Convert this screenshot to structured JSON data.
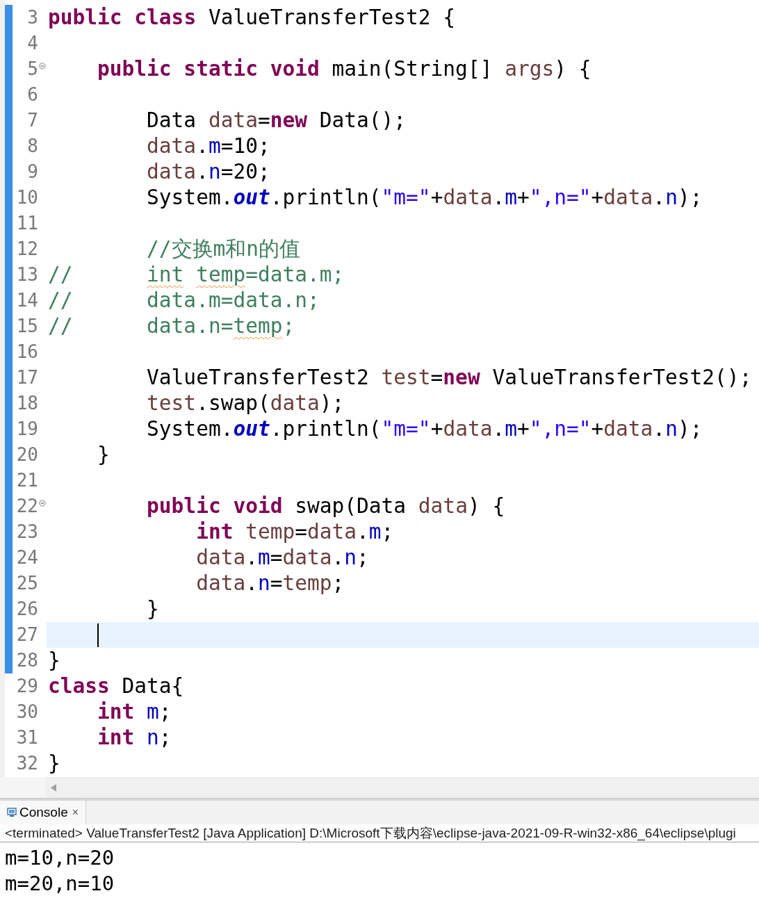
{
  "editor": {
    "lines": [
      {
        "number": "3",
        "changed": true,
        "tokens": [
          {
            "kind": "keyword",
            "text": "public"
          },
          {
            "kind": "keyword",
            "text": " class"
          },
          {
            "kind": "plain",
            "text": " ValueTransferTest2 {"
          }
        ]
      },
      {
        "number": "4",
        "changed": true
      },
      {
        "number": "5",
        "changed": true,
        "fold": true,
        "tokens": [
          {
            "kind": "keyword",
            "text": "    public"
          },
          {
            "kind": "keyword",
            "text": " static"
          },
          {
            "kind": "keyword",
            "text": " void"
          },
          {
            "kind": "plain",
            "text": " main(String[] "
          },
          {
            "kind": "variable",
            "text": "args"
          },
          {
            "kind": "plain",
            "text": ") {"
          }
        ]
      },
      {
        "number": "6",
        "changed": true
      },
      {
        "number": "7",
        "changed": true,
        "tokens": [
          {
            "kind": "plain",
            "text": "        Data "
          },
          {
            "kind": "variable",
            "text": "data"
          },
          {
            "kind": "plain",
            "text": "="
          },
          {
            "kind": "keyword",
            "text": "new"
          },
          {
            "kind": "plain",
            "text": " Data();"
          }
        ]
      },
      {
        "number": "8",
        "changed": true,
        "tokens": [
          {
            "kind": "variable",
            "text": "        data"
          },
          {
            "kind": "plain",
            "text": "."
          },
          {
            "kind": "field",
            "text": "m"
          },
          {
            "kind": "plain",
            "text": "=10;"
          }
        ]
      },
      {
        "number": "9",
        "changed": true,
        "tokens": [
          {
            "kind": "variable",
            "text": "        data"
          },
          {
            "kind": "plain",
            "text": "."
          },
          {
            "kind": "field",
            "text": "n"
          },
          {
            "kind": "plain",
            "text": "=20;"
          }
        ]
      },
      {
        "number": "10",
        "changed": true,
        "tokens": [
          {
            "kind": "plain",
            "text": "        System."
          },
          {
            "kind": "static",
            "text": "out"
          },
          {
            "kind": "plain",
            "text": ".println("
          },
          {
            "kind": "string",
            "text": "\"m=\""
          },
          {
            "kind": "plain",
            "text": "+"
          },
          {
            "kind": "variable",
            "text": "data"
          },
          {
            "kind": "plain",
            "text": "."
          },
          {
            "kind": "field",
            "text": "m"
          },
          {
            "kind": "plain",
            "text": "+"
          },
          {
            "kind": "string",
            "text": "\",n=\""
          },
          {
            "kind": "plain",
            "text": "+"
          },
          {
            "kind": "variable",
            "text": "data"
          },
          {
            "kind": "plain",
            "text": "."
          },
          {
            "kind": "field",
            "text": "n"
          },
          {
            "kind": "plain",
            "text": ");"
          }
        ]
      },
      {
        "number": "11",
        "changed": true
      },
      {
        "number": "12",
        "changed": true,
        "tokens": [
          {
            "kind": "comment",
            "text": "        //交换m和n的值"
          }
        ]
      },
      {
        "number": "13",
        "changed": true,
        "tokens": [
          {
            "kind": "comment",
            "text": "//      "
          },
          {
            "kind": "comment",
            "text": "int",
            "warning": true
          },
          {
            "kind": "comment",
            "text": " temp",
            "warning": true
          },
          {
            "kind": "comment",
            "text": "=data.m;"
          }
        ]
      },
      {
        "number": "14",
        "changed": true,
        "tokens": [
          {
            "kind": "comment",
            "text": "//      data.m=data.n;"
          }
        ]
      },
      {
        "number": "15",
        "changed": true,
        "tokens": [
          {
            "kind": "comment",
            "text": "//      data.n="
          },
          {
            "kind": "comment",
            "text": "temp",
            "warning": true
          },
          {
            "kind": "comment",
            "text": ";"
          }
        ]
      },
      {
        "number": "16",
        "changed": true
      },
      {
        "number": "17",
        "changed": true,
        "tokens": [
          {
            "kind": "plain",
            "text": "        ValueTransferTest2 "
          },
          {
            "kind": "variable",
            "text": "test"
          },
          {
            "kind": "plain",
            "text": "="
          },
          {
            "kind": "keyword",
            "text": "new"
          },
          {
            "kind": "plain",
            "text": " ValueTransferTest2();"
          }
        ]
      },
      {
        "number": "18",
        "changed": true,
        "tokens": [
          {
            "kind": "variable",
            "text": "        test"
          },
          {
            "kind": "plain",
            "text": ".swap("
          },
          {
            "kind": "variable",
            "text": "data"
          },
          {
            "kind": "plain",
            "text": ");"
          }
        ]
      },
      {
        "number": "19",
        "changed": true,
        "tokens": [
          {
            "kind": "plain",
            "text": "        System."
          },
          {
            "kind": "static",
            "text": "out"
          },
          {
            "kind": "plain",
            "text": ".println("
          },
          {
            "kind": "string",
            "text": "\"m=\""
          },
          {
            "kind": "plain",
            "text": "+"
          },
          {
            "kind": "variable",
            "text": "data"
          },
          {
            "kind": "plain",
            "text": "."
          },
          {
            "kind": "field",
            "text": "m"
          },
          {
            "kind": "plain",
            "text": "+"
          },
          {
            "kind": "string",
            "text": "\",n=\""
          },
          {
            "kind": "plain",
            "text": "+"
          },
          {
            "kind": "variable",
            "text": "data"
          },
          {
            "kind": "plain",
            "text": "."
          },
          {
            "kind": "field",
            "text": "n"
          },
          {
            "kind": "plain",
            "text": ");"
          }
        ]
      },
      {
        "number": "20",
        "changed": true,
        "tokens": [
          {
            "kind": "plain",
            "text": "    }"
          }
        ]
      },
      {
        "number": "21",
        "changed": true
      },
      {
        "number": "22",
        "changed": true,
        "fold": true,
        "tokens": [
          {
            "kind": "keyword",
            "text": "        public"
          },
          {
            "kind": "keyword",
            "text": " void"
          },
          {
            "kind": "plain",
            "text": " swap(Data "
          },
          {
            "kind": "variable",
            "text": "data"
          },
          {
            "kind": "plain",
            "text": ") {"
          }
        ]
      },
      {
        "number": "23",
        "changed": true,
        "tokens": [
          {
            "kind": "keyword",
            "text": "            int"
          },
          {
            "kind": "variable",
            "text": " temp"
          },
          {
            "kind": "plain",
            "text": "="
          },
          {
            "kind": "variable",
            "text": "data"
          },
          {
            "kind": "plain",
            "text": "."
          },
          {
            "kind": "field",
            "text": "m"
          },
          {
            "kind": "plain",
            "text": ";"
          }
        ]
      },
      {
        "number": "24",
        "changed": true,
        "tokens": [
          {
            "kind": "variable",
            "text": "            data"
          },
          {
            "kind": "plain",
            "text": "."
          },
          {
            "kind": "field",
            "text": "m"
          },
          {
            "kind": "plain",
            "text": "="
          },
          {
            "kind": "variable",
            "text": "data"
          },
          {
            "kind": "plain",
            "text": "."
          },
          {
            "kind": "field",
            "text": "n"
          },
          {
            "kind": "plain",
            "text": ";"
          }
        ]
      },
      {
        "number": "25",
        "changed": true,
        "tokens": [
          {
            "kind": "variable",
            "text": "            data"
          },
          {
            "kind": "plain",
            "text": "."
          },
          {
            "kind": "field",
            "text": "n"
          },
          {
            "kind": "plain",
            "text": "="
          },
          {
            "kind": "variable",
            "text": "temp"
          },
          {
            "kind": "plain",
            "text": ";"
          }
        ]
      },
      {
        "number": "26",
        "changed": true,
        "tokens": [
          {
            "kind": "plain",
            "text": "        }"
          }
        ]
      },
      {
        "number": "27",
        "changed": true,
        "current": true
      },
      {
        "number": "28",
        "changed": true,
        "tokens": [
          {
            "kind": "plain",
            "text": "}"
          }
        ]
      },
      {
        "number": "29",
        "changed": false,
        "tokens": [
          {
            "kind": "keyword",
            "text": "class"
          },
          {
            "kind": "plain",
            "text": " Data{"
          }
        ]
      },
      {
        "number": "30",
        "changed": false,
        "tokens": [
          {
            "kind": "keyword",
            "text": "    int"
          },
          {
            "kind": "field",
            "text": " m"
          },
          {
            "kind": "plain",
            "text": ";"
          }
        ]
      },
      {
        "number": "31",
        "changed": false,
        "tokens": [
          {
            "kind": "keyword",
            "text": "    int"
          },
          {
            "kind": "field",
            "text": " n"
          },
          {
            "kind": "plain",
            "text": ";"
          }
        ]
      },
      {
        "number": "32",
        "changed": false,
        "tokens": [
          {
            "kind": "plain",
            "text": "}"
          }
        ]
      }
    ]
  },
  "console": {
    "tab": {
      "label": "Console",
      "close": "×"
    },
    "header": "<terminated> ValueTransferTest2 [Java Application] D:\\Microsoft下载内容\\eclipse-java-2021-09-R-win32-x86_64\\eclipse\\plugi",
    "output": [
      "m=10,n=20",
      "m=20,n=10"
    ]
  }
}
